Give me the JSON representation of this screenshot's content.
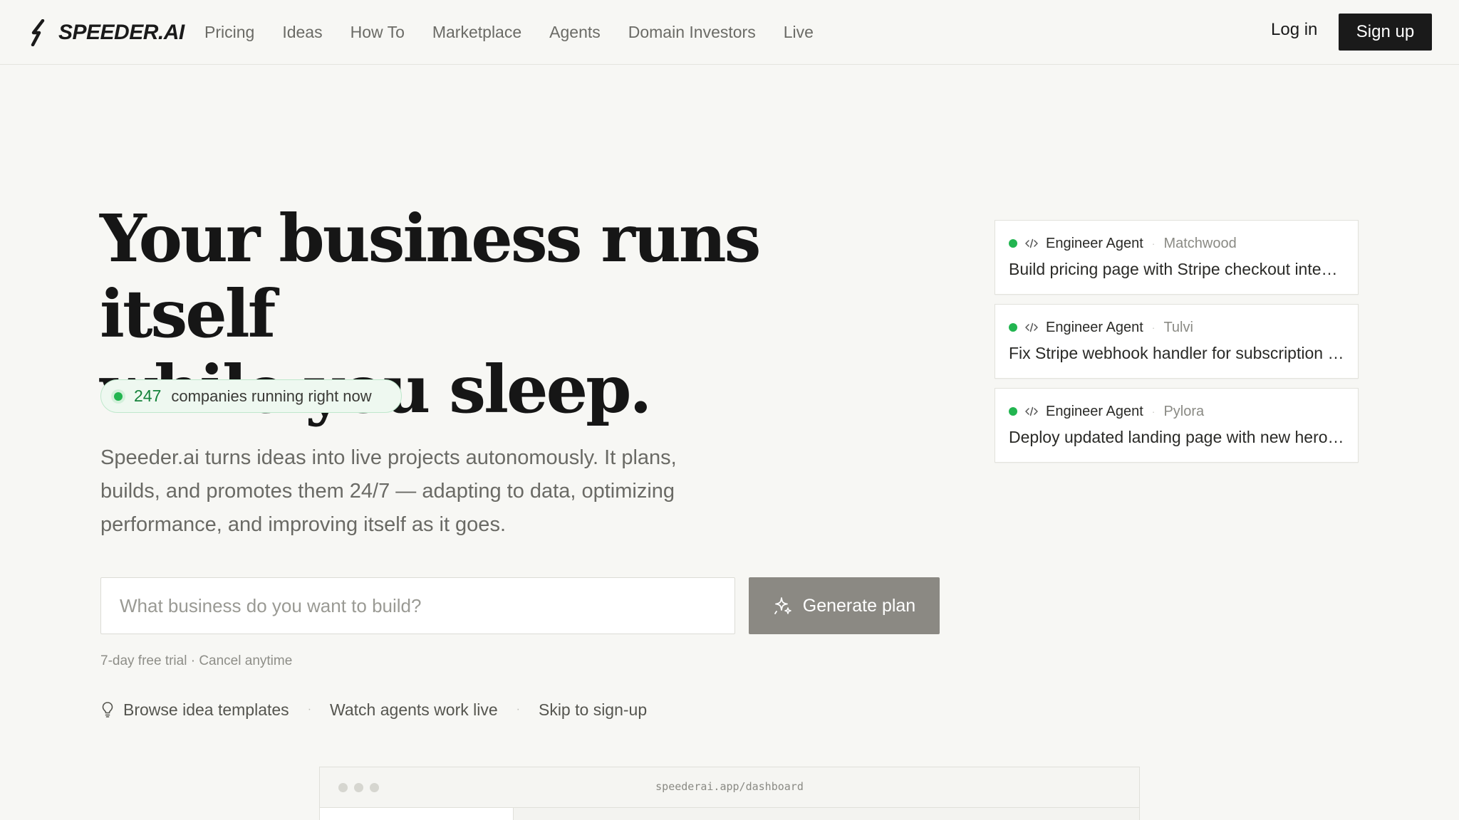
{
  "brand": {
    "name": "SPEEDER.AI"
  },
  "nav": {
    "links": [
      "Pricing",
      "Ideas",
      "How To",
      "Marketplace",
      "Agents",
      "Domain Investors",
      "Live"
    ],
    "login": "Log in",
    "signup": "Sign up"
  },
  "hero": {
    "title_line1": "Your business runs itself",
    "title_line2": "while you sleep.",
    "status_count": "247",
    "status_text": "companies running right now",
    "description": "Speeder.ai turns ideas into live projects autonomously. It plans, builds, and promotes them 24/7 — adapting to data, optimizing performance, and improving itself as it goes.",
    "input_placeholder": "What business do you want to build?",
    "generate_label": "Generate plan",
    "trial_note": "7-day free trial · Cancel anytime",
    "secondary_links": [
      "Browse idea templates",
      "Watch agents work live",
      "Skip to sign-up"
    ]
  },
  "agent_cards": [
    {
      "agent": "Engineer Agent",
      "project": "Matchwood",
      "task": "Build pricing page with Stripe checkout integration"
    },
    {
      "agent": "Engineer Agent",
      "project": "Tulvi",
      "task": "Fix Stripe webhook handler for subscription events"
    },
    {
      "agent": "Engineer Agent",
      "project": "Pylora",
      "task": "Deploy updated landing page with new hero section"
    }
  ],
  "preview": {
    "url": "speederai.app/dashboard"
  },
  "colors": {
    "accent_green": "#22b550",
    "dark": "#1a1a1a",
    "button_gray": "#8b8983",
    "background": "#f7f7f4"
  },
  "icons": [
    "bolt-logo-icon",
    "sparkle-icon",
    "lightbulb-icon",
    "code-icon"
  ]
}
